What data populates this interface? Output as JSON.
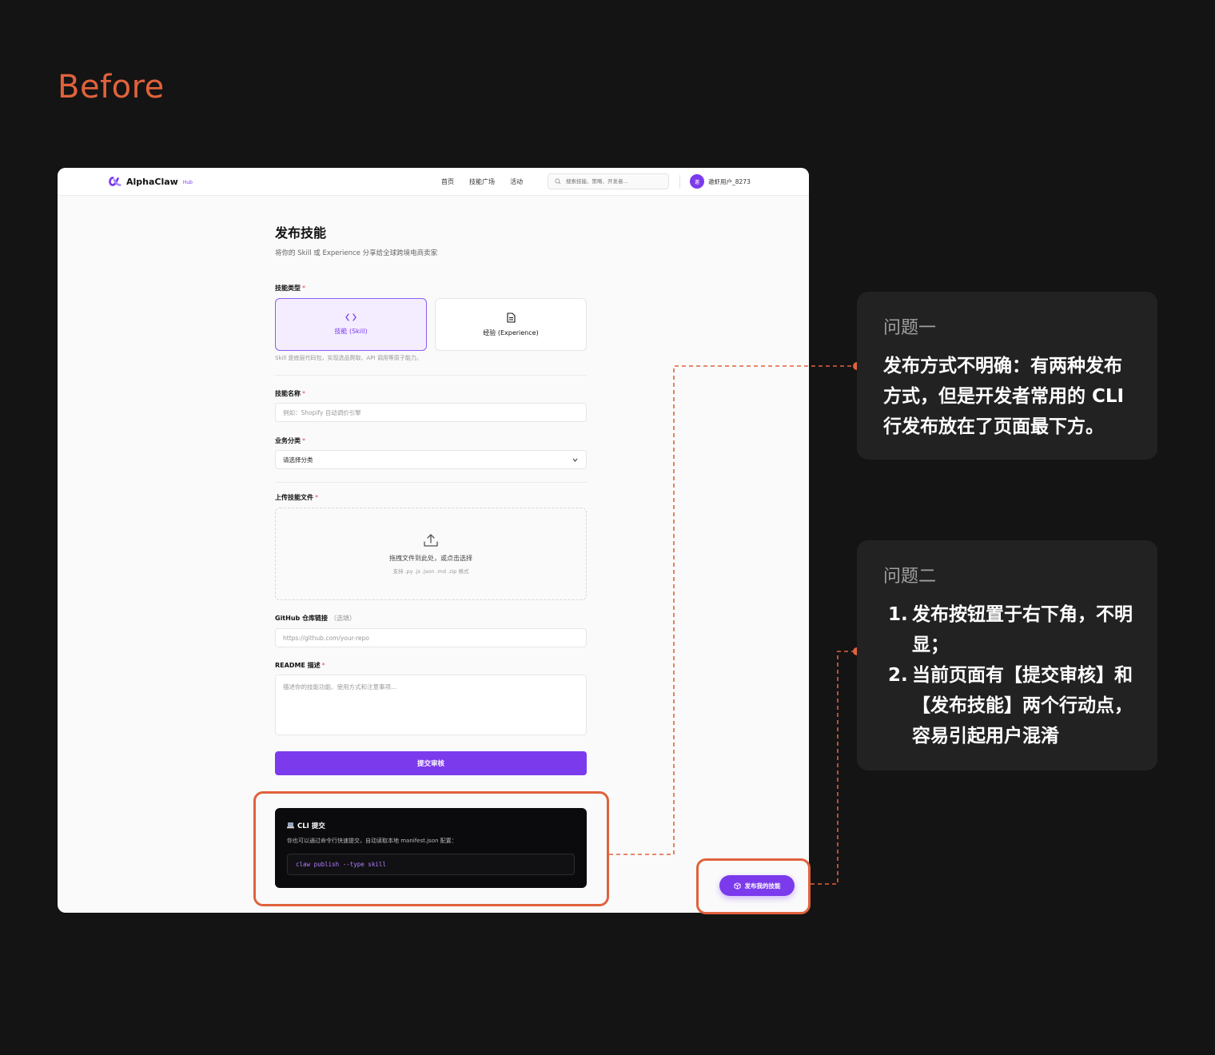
{
  "heading": "Before",
  "app": {
    "brand": "AlphaClaw",
    "brand_tag": "Hub",
    "nav": [
      "首页",
      "技能广场",
      "活动"
    ],
    "search_placeholder": "搜索技能、策略、开发者...",
    "avatar_text": "邀",
    "username": "邀虾用户_8273"
  },
  "form": {
    "title": "发布技能",
    "subtitle": "将你的 Skill 或 Experience 分享给全球跨境电商卖家",
    "type_label": "技能类型",
    "types": [
      {
        "label": "技能 (Skill)",
        "icon": "code-icon",
        "selected": true
      },
      {
        "label": "经验 (Experience)",
        "icon": "document-icon",
        "selected": false
      }
    ],
    "type_hint": "Skill 是底层代码包，实现选品爬取、API 调用等原子能力。",
    "name_label": "技能名称",
    "name_placeholder": "例如：Shopify 自动调价引擎",
    "category_label": "业务分类",
    "category_value": "请选择分类",
    "upload_label": "上传技能文件",
    "upload_main": "拖拽文件到此处，或点击选择",
    "upload_sub": "支持 .py .js .json .md .zip 格式",
    "github_label": "GitHub 仓库链接",
    "github_optional": "（选填）",
    "github_placeholder": "https://github.com/your-repo",
    "readme_label": "README 描述",
    "readme_placeholder": "描述你的技能功能、使用方式和注意事项...",
    "submit": "提交审核",
    "required_mark": "*"
  },
  "cli": {
    "title": "CLI 提交",
    "desc": "你也可以通过命令行快速提交，自动读取本地 manifest.json 配置：",
    "command": "claw publish --type skill"
  },
  "publish_button": "发布我的技能",
  "notes": [
    {
      "title": "问题一",
      "body": "发布方式不明确：有两种发布方式，但是开发者常用的 CLI 行发布放在了页面最下方。"
    },
    {
      "title": "问题二",
      "items": [
        {
          "num": "1.",
          "text": "发布按钮置于右下角，不明显；"
        },
        {
          "num": "2.",
          "text": "当前页面有【提交审核】和【发布技能】两个行动点，容易引起用户混淆"
        }
      ]
    }
  ],
  "colors": {
    "accent": "#7c3aed",
    "annotation": "#e0623c",
    "background": "#141414"
  }
}
